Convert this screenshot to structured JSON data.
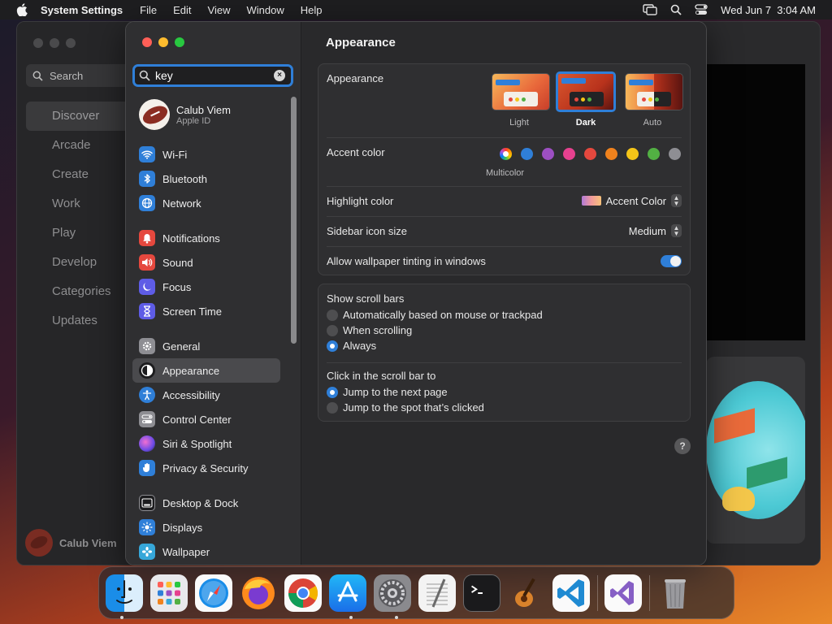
{
  "menubar": {
    "app_name": "System Settings",
    "menus": [
      "File",
      "Edit",
      "View",
      "Window",
      "Help"
    ],
    "clock": "Wed Jun 7  3:04 AM"
  },
  "background_app": {
    "search_placeholder": "Search",
    "nav": [
      "Discover",
      "Arcade",
      "Create",
      "Work",
      "Play",
      "Develop",
      "Categories",
      "Updates"
    ],
    "selected": "Discover",
    "user_name": "Calub Viem"
  },
  "sidebar": {
    "search_value": "key",
    "account": {
      "name": "Calub Viem",
      "subtitle": "Apple ID"
    },
    "groups": [
      [
        {
          "label": "Wi-Fi",
          "icon": "wifi-icon",
          "color": "#2f7fd8"
        },
        {
          "label": "Bluetooth",
          "icon": "bluetooth-icon",
          "color": "#2f7fd8"
        },
        {
          "label": "Network",
          "icon": "globe-icon",
          "color": "#2f7fd8"
        }
      ],
      [
        {
          "label": "Notifications",
          "icon": "bell-icon",
          "color": "#e5483e"
        },
        {
          "label": "Sound",
          "icon": "speaker-icon",
          "color": "#e5483e"
        },
        {
          "label": "Focus",
          "icon": "moon-icon",
          "color": "#5e5ce6"
        },
        {
          "label": "Screen Time",
          "icon": "hourglass-icon",
          "color": "#5e5ce6"
        }
      ],
      [
        {
          "label": "General",
          "icon": "gear-icon",
          "color": "#8e8e93"
        },
        {
          "label": "Appearance",
          "icon": "appearance-icon",
          "color": "#1c1c1e",
          "selected": true
        },
        {
          "label": "Accessibility",
          "icon": "accessibility-icon",
          "color": "#2f7fd8"
        },
        {
          "label": "Control Center",
          "icon": "control-center-icon",
          "color": "#8e8e93"
        },
        {
          "label": "Siri & Spotlight",
          "icon": "siri-icon",
          "color": "#b44fd8"
        },
        {
          "label": "Privacy & Security",
          "icon": "hand-icon",
          "color": "#2f7fd8"
        }
      ],
      [
        {
          "label": "Desktop & Dock",
          "icon": "dock-icon",
          "color": "#1c1c1e"
        },
        {
          "label": "Displays",
          "icon": "sun-icon",
          "color": "#2f7fd8"
        },
        {
          "label": "Wallpaper",
          "icon": "flower-icon",
          "color": "#36a7d9"
        }
      ]
    ]
  },
  "content": {
    "title": "Appearance",
    "appearance": {
      "label": "Appearance",
      "options": [
        "Light",
        "Dark",
        "Auto"
      ],
      "selected": "Dark"
    },
    "accent": {
      "label": "Accent color",
      "colors": [
        "multicolor",
        "#2f7fd8",
        "#9c4fc2",
        "#e6418f",
        "#e5483e",
        "#f0821d",
        "#f5c518",
        "#52b043",
        "#8e8e93"
      ],
      "selected_label": "Multicolor"
    },
    "highlight": {
      "label": "Highlight color",
      "value": "Accent Color"
    },
    "sidebar_icon_size": {
      "label": "Sidebar icon size",
      "value": "Medium"
    },
    "wallpaper_tinting": {
      "label": "Allow wallpaper tinting in windows",
      "on": true
    },
    "scroll_bars": {
      "label": "Show scroll bars",
      "options": [
        "Automatically based on mouse or trackpad",
        "When scrolling",
        "Always"
      ],
      "selected": "Always"
    },
    "click_scroll": {
      "label": "Click in the scroll bar to",
      "options": [
        "Jump to the next page",
        "Jump to the spot that’s clicked"
      ],
      "selected": "Jump to the next page"
    },
    "help": "?"
  },
  "dock": {
    "apps": [
      "Finder",
      "Launchpad",
      "Safari",
      "Firefox",
      "Chrome",
      "App Store",
      "System Settings",
      "TextEdit",
      "Terminal",
      "GarageBand",
      "Visual Studio Code",
      "Visual Studio",
      "Trash"
    ]
  }
}
